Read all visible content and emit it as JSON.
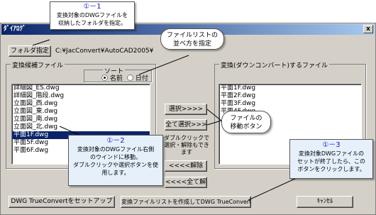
{
  "dialog": {
    "title": "ﾀﾞｲｱﾛｸﾞ",
    "close_label": "x"
  },
  "folder": {
    "button_label": "フォルダ指定",
    "path": "C:¥JacConvert¥AutoCAD2005¥"
  },
  "sort": {
    "label": "ソート",
    "option_name": "名前",
    "option_date": "日付",
    "selected": "名前"
  },
  "candidates": {
    "label": "変換候補ファイル",
    "items": [
      "詳細図_ES.dwg",
      "詳細図_階段.dwg",
      "立面図_西.dwg",
      "立面図_東.dwg",
      "立面図_南.dwg",
      "立面図_北.dwg",
      "平面1F.dwg",
      "平面5F.dwg",
      "平面6F.dwg"
    ],
    "selected_index": 6
  },
  "targets": {
    "label": "変換(ダウンコンバート)するファイル",
    "items": [
      "平面1F.dwg",
      "平面2F.dwg",
      "平面3F.dwg",
      "平面4F.dwg"
    ]
  },
  "buttons": {
    "select": "選択>>>>",
    "select_all": "全て選択>>>>",
    "remove": "<<<<解除",
    "remove_all": "<<<<全て解除",
    "setup": "DWG TrueConvertをセットアップ",
    "launch": "変換ファイルリストを作成してDWG TrueConvertを起動",
    "cancel": "ｷｬﾝｾﾙ"
  },
  "hint": {
    "line1": "ダブルクリックで",
    "line2": "選択・解除もでき",
    "line3": "ます"
  },
  "callouts": {
    "c1": {
      "num": "①－1",
      "line1": "変換対象のDWGファイルを",
      "line2": "収納したフォルダを指定。"
    },
    "sort_note": {
      "line1": "ファイルリストの",
      "line2": "並べ方を指定"
    },
    "move": {
      "line1": "ファイルの",
      "line2": "移動ボタン"
    },
    "c2": {
      "num": "①－2",
      "line1": "変換対象のDWGファイル右側",
      "line2": "のウインドに移動。",
      "line3": "ダブルクリックや選択ボタンを使",
      "line4": "用します。"
    },
    "c3": {
      "num": "①－3",
      "line1": "変換対象DWGファイルの",
      "line2": "セットが終了したら、この",
      "line3": "ボタンをクリックします。"
    }
  }
}
